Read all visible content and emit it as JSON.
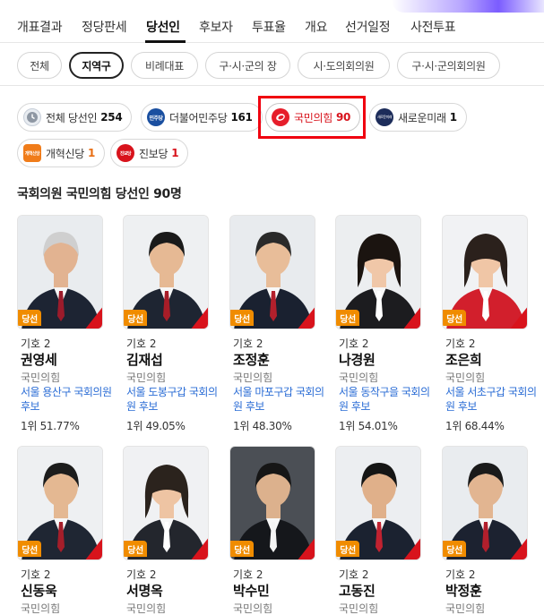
{
  "top_tabs": [
    "개표결과",
    "정당판세",
    "당선인",
    "후보자",
    "투표율",
    "개요",
    "선거일정",
    "사전투표"
  ],
  "sub_tabs": [
    "전체",
    "지역구",
    "비례대표",
    "구·시·군의 장",
    "시·도의회의원",
    "구·시·군의회의원"
  ],
  "party_filters": [
    {
      "label": "전체 당선인",
      "count": "254",
      "logo_text": "",
      "color": "#8e97a3"
    },
    {
      "label": "더불어민주당",
      "count": "161",
      "logo_text": "민주당",
      "color": "#1a4fa0"
    },
    {
      "label": "국민의힘",
      "count": "90",
      "logo_text": "",
      "color": "#e61e2b"
    },
    {
      "label": "새로운미래",
      "count": "1",
      "logo_text": "새로운미래",
      "color": "#1c2c5a"
    },
    {
      "label": "개혁신당",
      "count": "1",
      "logo_text": "개혁신당",
      "color": "#f07c1a"
    },
    {
      "label": "진보당",
      "count": "1",
      "logo_text": "진보당",
      "color": "#d8131c"
    }
  ],
  "section_title": "국회의원 국민의힘 당선인 90명",
  "badge_label": "당선",
  "candidates": [
    {
      "number": "기호 2",
      "name": "권영세",
      "party": "국민의힘",
      "district": "서울 용산구 국회의원 후보",
      "result": "1위 51.77%"
    },
    {
      "number": "기호 2",
      "name": "김재섭",
      "party": "국민의힘",
      "district": "서울 도봉구갑 국회의원 후보",
      "result": "1위 49.05%"
    },
    {
      "number": "기호 2",
      "name": "조정훈",
      "party": "국민의힘",
      "district": "서울 마포구갑 국회의원 후보",
      "result": "1위 48.30%"
    },
    {
      "number": "기호 2",
      "name": "나경원",
      "party": "국민의힘",
      "district": "서울 동작구을 국회의원 후보",
      "result": "1위 54.01%"
    },
    {
      "number": "기호 2",
      "name": "조은희",
      "party": "국민의힘",
      "district": "서울 서초구갑 국회의원 후보",
      "result": "1위 68.44%"
    },
    {
      "number": "기호 2",
      "name": "신동욱",
      "party": "국민의힘",
      "district": "",
      "result": ""
    },
    {
      "number": "기호 2",
      "name": "서명옥",
      "party": "국민의힘",
      "district": "",
      "result": ""
    },
    {
      "number": "기호 2",
      "name": "박수민",
      "party": "국민의힘",
      "district": "",
      "result": ""
    },
    {
      "number": "기호 2",
      "name": "고동진",
      "party": "국민의힘",
      "district": "",
      "result": ""
    },
    {
      "number": "기호 2",
      "name": "박정훈",
      "party": "국민의힘",
      "district": "",
      "result": ""
    }
  ],
  "colors": {
    "accent_orange": "#f08c00",
    "district_blue": "#2a6cd5",
    "ppp_red": "#e61e2b",
    "highlight": "#f0000f"
  }
}
